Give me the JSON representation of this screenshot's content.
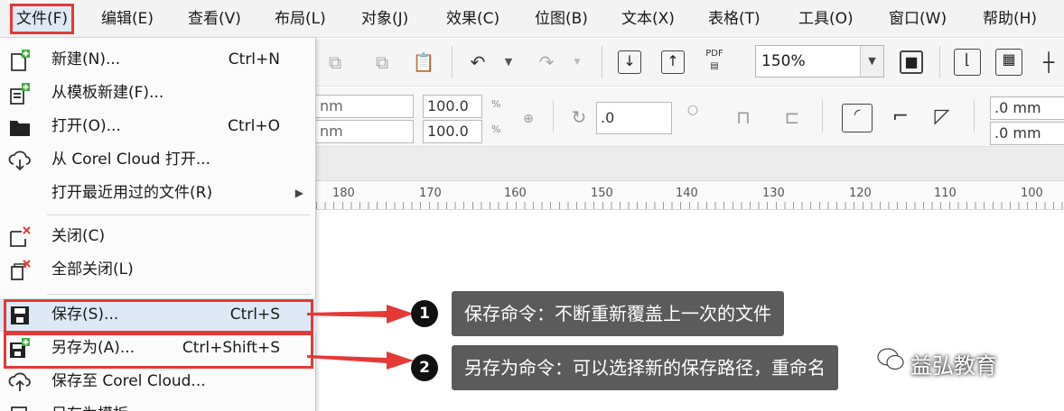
{
  "menubar": {
    "items": [
      "文件(F)",
      "编辑(E)",
      "查看(V)",
      "布局(L)",
      "对象(J)",
      "效果(C)",
      "位图(B)",
      "文本(X)",
      "表格(T)",
      "工具(O)",
      "窗口(W)",
      "帮助(H)"
    ],
    "active_index": 0
  },
  "toolbar": {
    "zoom_value": "150%",
    "pdf_label": "PDF",
    "size_partial_1": "nm",
    "size_partial_2": "nm",
    "scale_x": "100.0",
    "scale_y": "100.0",
    "percent_sign": "%",
    "rotation": ".0",
    "corner_1": ".0 mm",
    "corner_2": ".0 mm"
  },
  "ruler": {
    "labels": [
      "180",
      "170",
      "160",
      "150",
      "140",
      "130",
      "120",
      "110",
      "100"
    ]
  },
  "file_menu": {
    "items": [
      {
        "label": "新建(N)...",
        "shortcut": "Ctrl+N",
        "icon": "new-document-icon"
      },
      {
        "label": "从模板新建(F)...",
        "shortcut": "",
        "icon": "new-from-template-icon"
      },
      {
        "label": "打开(O)...",
        "shortcut": "Ctrl+O",
        "icon": "folder-open-icon"
      },
      {
        "label": "从 Corel Cloud 打开...",
        "shortcut": "",
        "icon": "cloud-download-icon"
      },
      {
        "label": "打开最近用过的文件(R)",
        "shortcut": "",
        "icon": "",
        "submenu": true
      },
      {
        "label": "关闭(C)",
        "shortcut": "",
        "icon": "close-document-icon"
      },
      {
        "label": "全部关闭(L)",
        "shortcut": "",
        "icon": "close-all-icon"
      },
      {
        "label": "保存(S)...",
        "shortcut": "Ctrl+S",
        "icon": "save-icon"
      },
      {
        "label": "另存为(A)...",
        "shortcut": "Ctrl+Shift+S",
        "icon": "save-as-icon"
      },
      {
        "label": "保存至 Corel Cloud...",
        "shortcut": "",
        "icon": "cloud-upload-icon"
      },
      {
        "label": "另存为模板...",
        "shortcut": "",
        "icon": "save-template-icon"
      }
    ]
  },
  "annotations": {
    "badge_1": "1",
    "badge_2": "2",
    "callout_1": "保存命令：不断重新覆盖上一次的文件",
    "callout_2": "另存为命令：可以选择新的保存路径，重命名"
  },
  "watermark": "益弘教育",
  "colors": {
    "highlight_red": "#e53935",
    "callout_bg": "#5b5b5b",
    "menu_bg": "#f3f3f3",
    "hover_bg": "#dce8f5"
  }
}
